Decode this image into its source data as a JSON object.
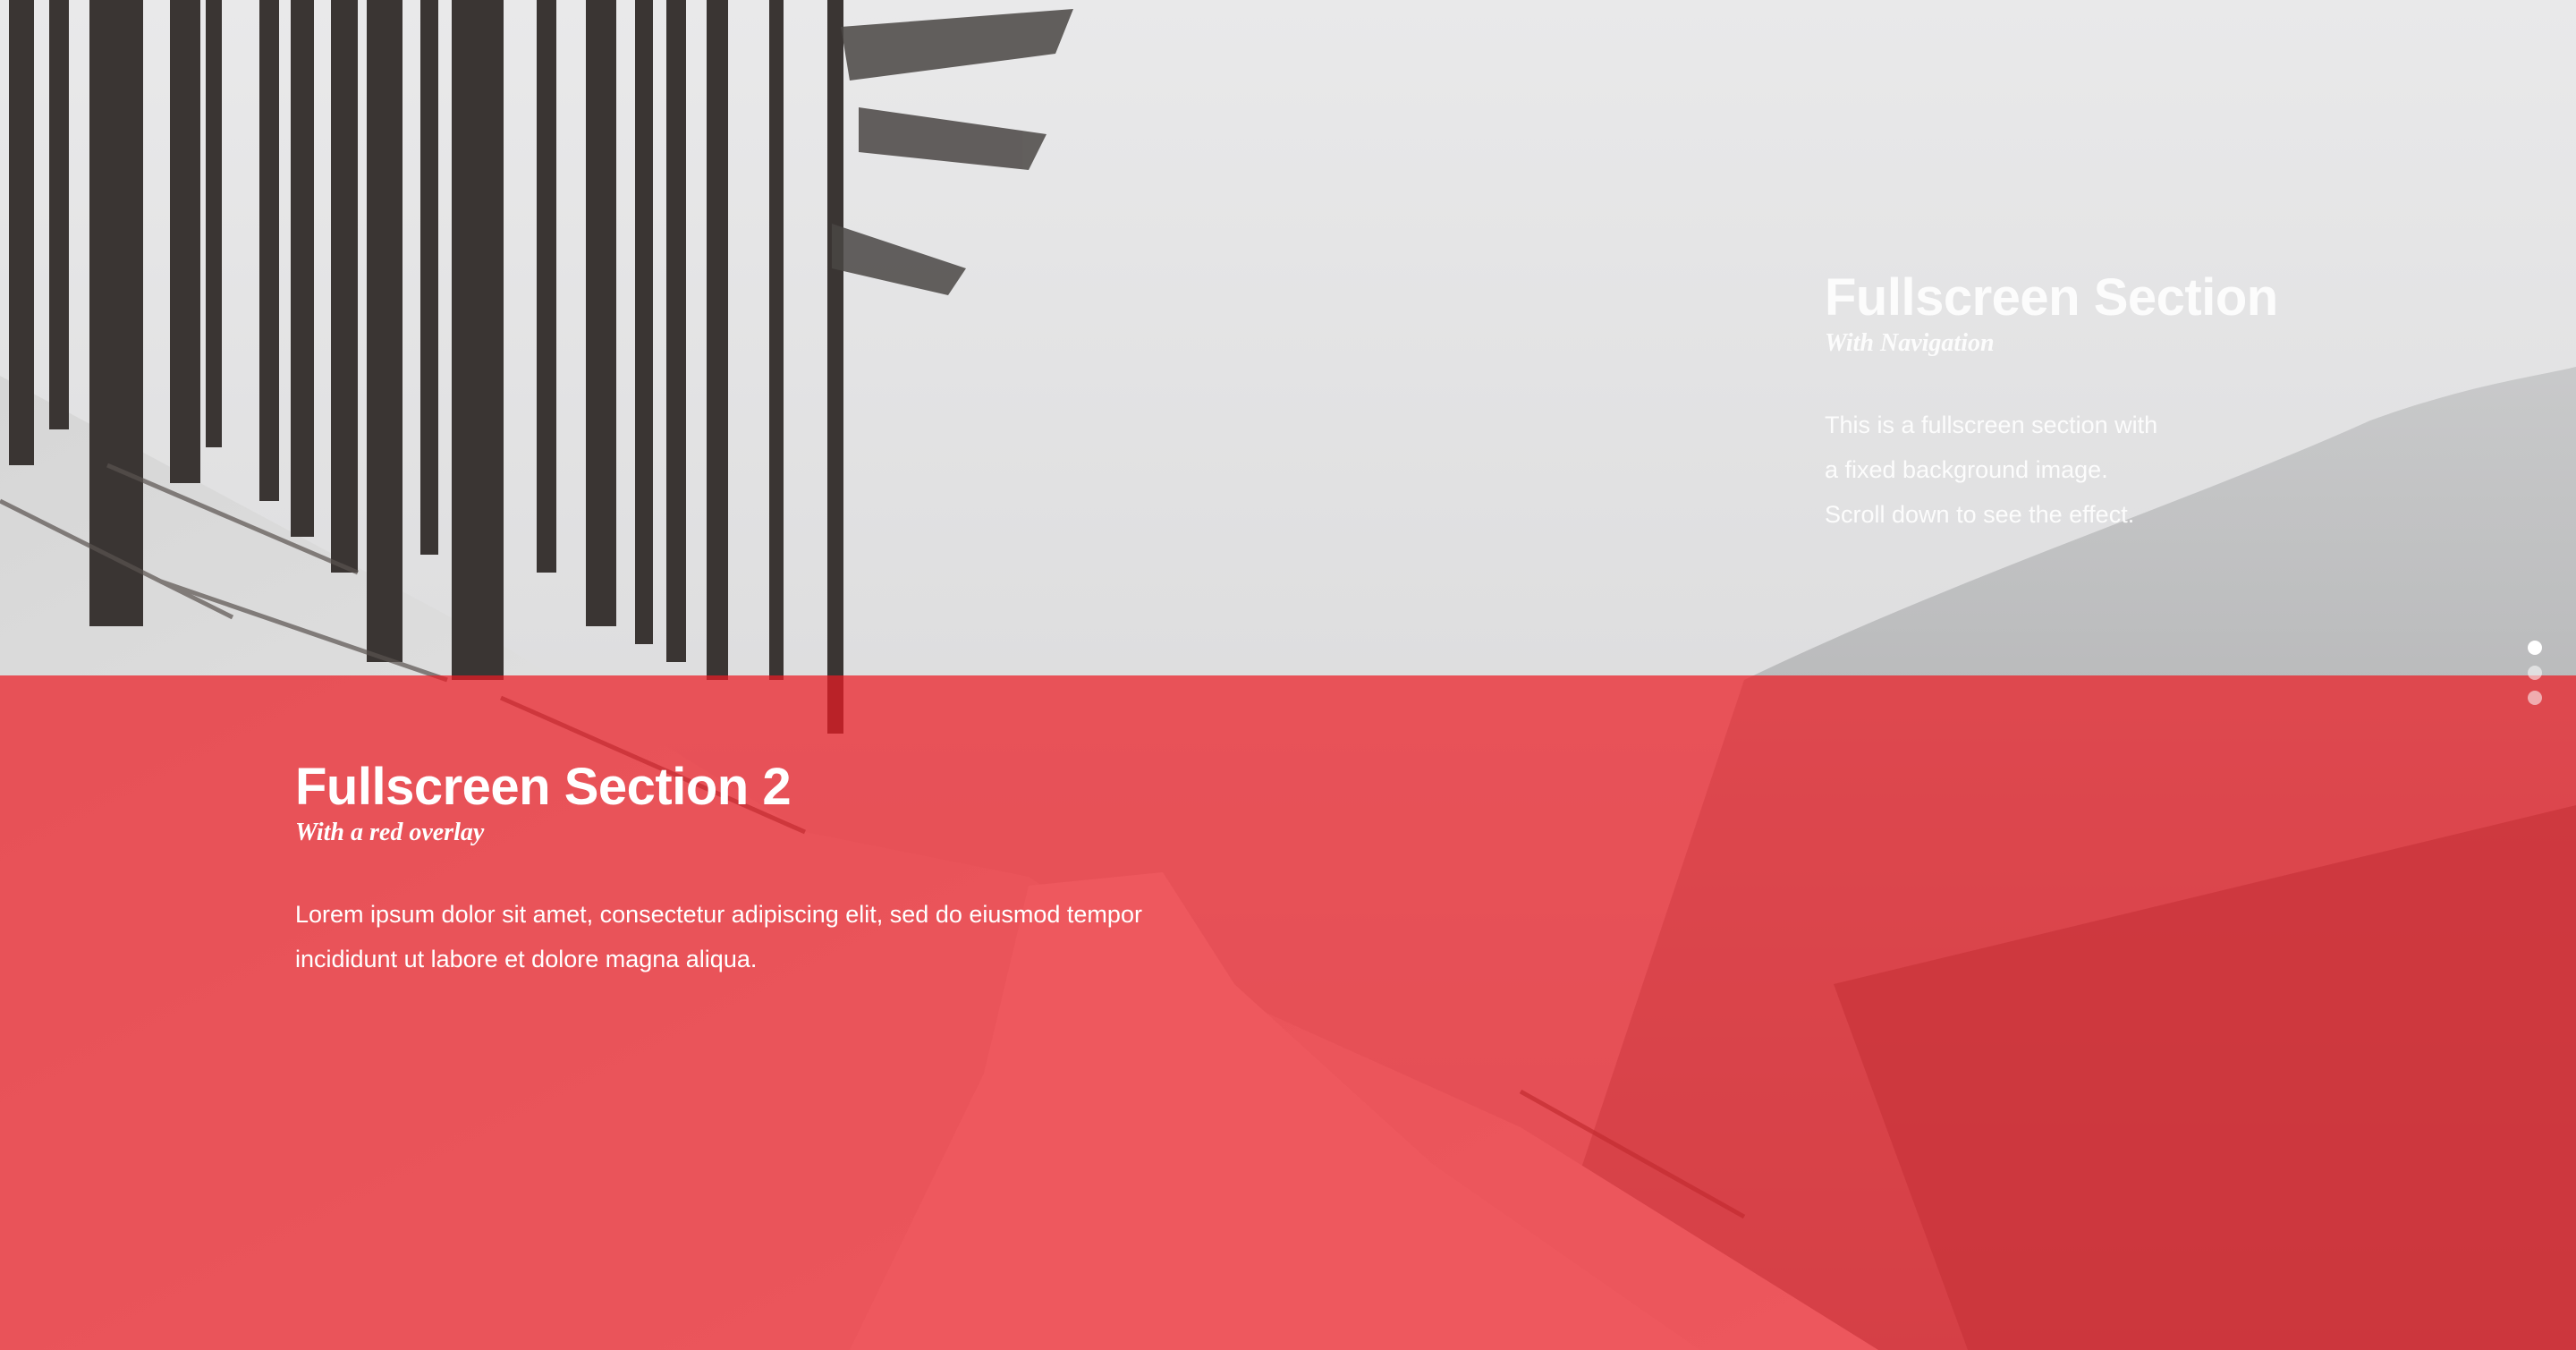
{
  "sections": [
    {
      "title": "Fullscreen Section",
      "subtitle": "With Navigation",
      "body_lines": [
        "This is a fullscreen section with",
        "a fixed background image.",
        "Scroll down to see the effect."
      ]
    },
    {
      "title": "Fullscreen Section 2",
      "subtitle": "With a red overlay",
      "body_lines": [
        "Lorem ipsum dolor sit amet, consectetur adipiscing elit, sed do eiusmod tempor",
        "incididunt ut labore et dolore magna aliqua."
      ],
      "overlay_color": "#ec1c24"
    }
  ],
  "navigation": {
    "dots": [
      {
        "label": "",
        "active": true
      },
      {
        "label": "",
        "active": false
      },
      {
        "label": "",
        "active": false
      }
    ]
  }
}
